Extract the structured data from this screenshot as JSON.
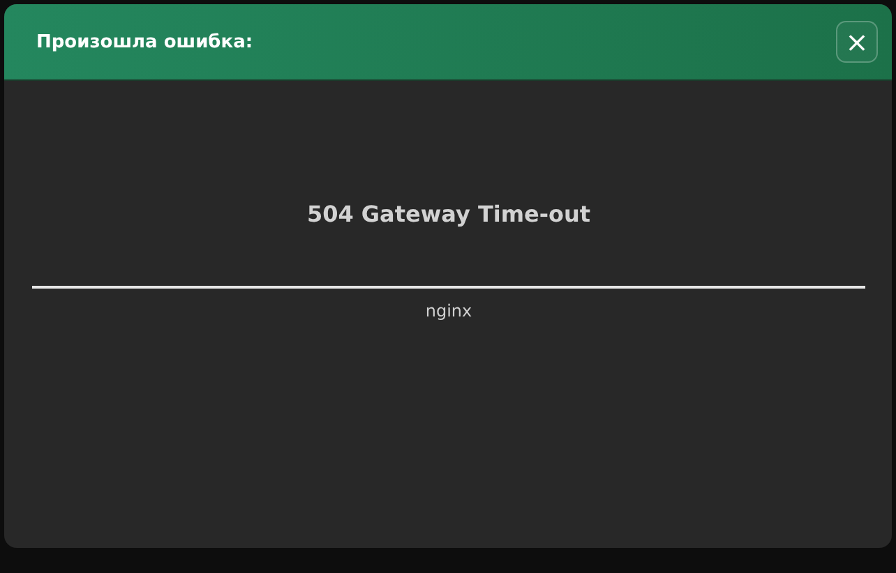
{
  "dialog": {
    "title": "Произошла ошибка:",
    "close_label": "×"
  },
  "error": {
    "heading": "504 Gateway Time-out",
    "server": "nginx"
  }
}
